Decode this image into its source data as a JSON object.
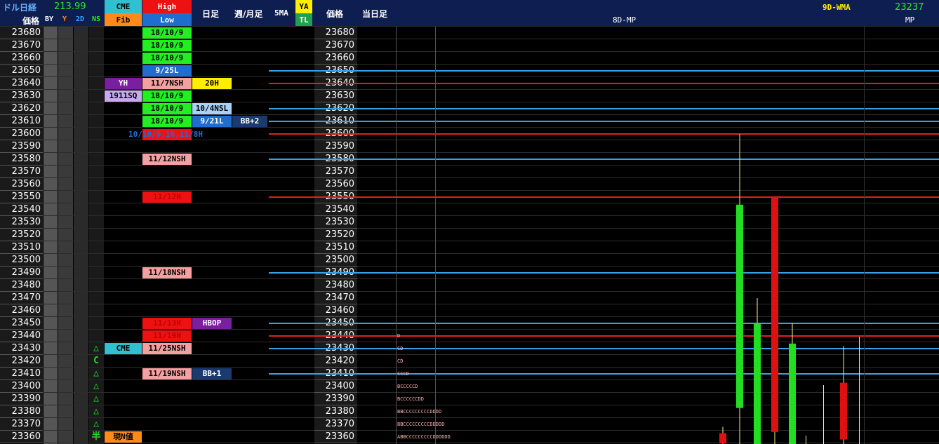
{
  "header": {
    "dollar_nikkei_label": "ドル日経",
    "dollar_nikkei_value": "213.99",
    "price_label": "価格",
    "by": "BY",
    "y": "Y",
    "d2": "2D",
    "ns": "NS",
    "cme": "CME",
    "fib": "Fib",
    "high": "High",
    "low": "Low",
    "daily": "日足",
    "weekly_monthly": "週/月足",
    "ma5": "5MA",
    "ya": "YA",
    "tl": "TL",
    "price_label2": "価格",
    "today_bar": "当日足",
    "mp8": "8D-MP",
    "wma9": "9D-WMA",
    "wma9_value": "23237",
    "mp": "MP"
  },
  "prices": [
    "23680",
    "23670",
    "23660",
    "23650",
    "23640",
    "23630",
    "23620",
    "23610",
    "23600",
    "23590",
    "23580",
    "23570",
    "23560",
    "23550",
    "23540",
    "23530",
    "23520",
    "23510",
    "23500",
    "23490",
    "23480",
    "23470",
    "23460",
    "23450",
    "23440",
    "23430",
    "23420",
    "23410",
    "23400",
    "23390",
    "23380",
    "23370",
    "23360"
  ],
  "ns_marks": [
    {
      "row": 25,
      "text": "△",
      "color": "#22dd22"
    },
    {
      "row": 26,
      "text": "C",
      "color": "#22dd22"
    },
    {
      "row": 27,
      "text": "△",
      "color": "#22dd22"
    },
    {
      "row": 28,
      "text": "△",
      "color": "#22dd22"
    },
    {
      "row": 29,
      "text": "△",
      "color": "#22dd22"
    },
    {
      "row": 30,
      "text": "△",
      "color": "#22dd22"
    },
    {
      "row": 31,
      "text": "△",
      "color": "#22dd22"
    },
    {
      "row": 32,
      "text": "半",
      "color": "#22dd22"
    }
  ],
  "cme_labels": [
    {
      "row": 4,
      "text": "YH",
      "bg": "#7a1fa0",
      "fg": "#ffffff"
    },
    {
      "row": 5,
      "text": "1911SQ",
      "bg": "#c8a8f0",
      "fg": "#000000"
    },
    {
      "row": 25,
      "text": "CME",
      "bg": "#30c0d0",
      "fg": "#000000"
    },
    {
      "row": 32,
      "text": "現N値",
      "bg": "#ff8a1a",
      "fg": "#000000"
    }
  ],
  "high_low_labels": [
    {
      "row": 0,
      "text": "18/10/9",
      "bg": "#22ee22",
      "fg": "#000"
    },
    {
      "row": 1,
      "text": "18/10/9",
      "bg": "#22ee22",
      "fg": "#000"
    },
    {
      "row": 2,
      "text": "18/10/9",
      "bg": "#22ee22",
      "fg": "#000"
    },
    {
      "row": 3,
      "text": "9/25L",
      "bg": "#1e6ed0",
      "fg": "#fff"
    },
    {
      "row": 4,
      "text": "11/7NSH",
      "bg": "#f4a0a0",
      "fg": "#000"
    },
    {
      "row": 5,
      "text": "18/10/9",
      "bg": "#22ee22",
      "fg": "#000"
    },
    {
      "row": 6,
      "text": "18/10/9",
      "bg": "#22ee22",
      "fg": "#000"
    },
    {
      "row": 7,
      "text": "18/10/9",
      "bg": "#22ee22",
      "fg": "#000"
    },
    {
      "row": 10,
      "text": "11/12NSH",
      "bg": "#f4a0a0",
      "fg": "#000"
    },
    {
      "row": 13,
      "text": "11/12H",
      "bg": "#ee1111",
      "fg": "#b00"
    },
    {
      "row": 19,
      "text": "11/18NSH",
      "bg": "#f4a0a0",
      "fg": "#000"
    },
    {
      "row": 23,
      "text": "11/13H",
      "bg": "#ee1111",
      "fg": "#b00"
    },
    {
      "row": 24,
      "text": "11/19H",
      "bg": "#ee1111",
      "fg": "#b00"
    },
    {
      "row": 25,
      "text": "11/25NSH",
      "bg": "#f4a0a0",
      "fg": "#000"
    },
    {
      "row": 27,
      "text": "11/19NSH",
      "bg": "#f4a0a0",
      "fg": "#000"
    }
  ],
  "row8_label": "10/10/9,10,11/8H",
  "daily_labels": [
    {
      "row": 4,
      "text": "20H",
      "bg": "#ffee00",
      "fg": "#000"
    },
    {
      "row": 6,
      "text": "10/4NSL",
      "bg": "#a8d0f8",
      "fg": "#000"
    },
    {
      "row": 7,
      "text": "9/21L",
      "bg": "#1e6ed0",
      "fg": "#fff"
    },
    {
      "row": 23,
      "text": "HBOP",
      "bg": "#7a1fa0",
      "fg": "#fff"
    },
    {
      "row": 27,
      "text": "BB+1",
      "bg": "#1a3a70",
      "fg": "#fff"
    }
  ],
  "weekly_labels": [
    {
      "row": 7,
      "text": "BB+2",
      "bg": "#1a3a70",
      "fg": "#fff"
    }
  ],
  "mp_rows": [
    {
      "row": 24,
      "text": "D"
    },
    {
      "row": 25,
      "text": "CD"
    },
    {
      "row": 26,
      "text": "CD"
    },
    {
      "row": 27,
      "text": "CCCD"
    },
    {
      "row": 28,
      "text": "BCCCCCD"
    },
    {
      "row": 29,
      "text": "BCCCCCCDD"
    },
    {
      "row": 30,
      "text": "BBCCCCCCCCCDDDD"
    },
    {
      "row": 31,
      "text": "BBCCCCCCCCCDDDDD"
    },
    {
      "row": 32,
      "text": "ABBCCCCCCCCCDDDDDD"
    }
  ],
  "level_lines": [
    {
      "row": 3,
      "color": "#3aa0e8"
    },
    {
      "row": 4,
      "color": "#e02020"
    },
    {
      "row": 6,
      "color": "#3aa0e8"
    },
    {
      "row": 7,
      "color": "#3aa0e8"
    },
    {
      "row": 8,
      "color": "#e02020"
    },
    {
      "row": 10,
      "color": "#3aa0e8"
    },
    {
      "row": 13,
      "color": "#e02020"
    },
    {
      "row": 19,
      "color": "#3aa0e8"
    },
    {
      "row": 23,
      "color": "#3aa0e8"
    },
    {
      "row": 24,
      "color": "#e02020"
    },
    {
      "row": 25,
      "color": "#3aa0e8"
    },
    {
      "row": 27,
      "color": "#3aa0e8"
    }
  ],
  "candles": [
    {
      "color": "#dd1111",
      "open": 23355,
      "close": 23363,
      "high": 23368,
      "low": 23350
    },
    {
      "color": "#22dd22",
      "open": 23383,
      "close": 23544,
      "high": 23600,
      "low": 23330
    },
    {
      "color": "#22dd22",
      "open": 23300,
      "close": 23450,
      "high": 23470,
      "low": 23290
    },
    {
      "color": "#dd1111",
      "open": 23550,
      "close": 23364,
      "high": 23550,
      "low": 23340
    },
    {
      "color": "#22dd22",
      "open": 23340,
      "close": 23434,
      "high": 23450,
      "low": 23320
    },
    {
      "color": "#dd1111",
      "open": 23403,
      "close": 23358,
      "high": 23432,
      "low": 23340
    }
  ],
  "colors": {
    "header_bg": "#0e1e50",
    "green": "#22ee22",
    "red": "#ee1111",
    "blue_line": "#3aa0e8",
    "red_line": "#e02020"
  }
}
